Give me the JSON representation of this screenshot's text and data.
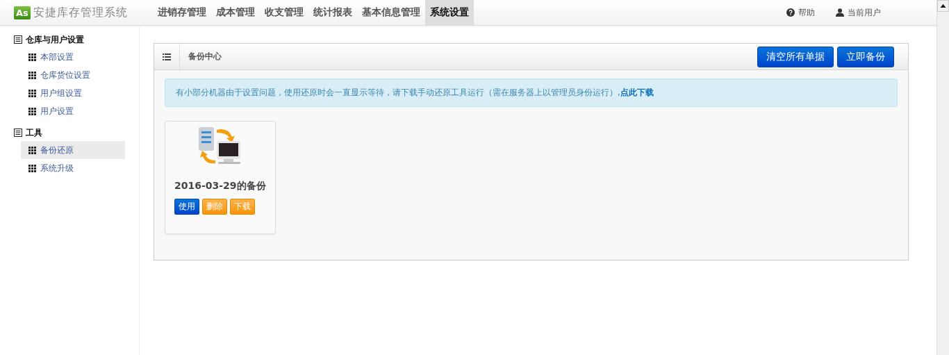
{
  "header": {
    "logo_mark": "As",
    "logo_text": "安捷库存管理系统",
    "nav": [
      {
        "label": "进销存管理",
        "selected": false
      },
      {
        "label": "成本管理",
        "selected": false
      },
      {
        "label": "收支管理",
        "selected": false
      },
      {
        "label": "统计报表",
        "selected": false
      },
      {
        "label": "基本信息管理",
        "selected": false
      },
      {
        "label": "系统设置",
        "selected": true
      }
    ],
    "help": "帮助",
    "user_label": "当前用户"
  },
  "sidebar": {
    "groups": [
      {
        "title": "仓库与用户设置",
        "items": [
          {
            "label": "本部设置",
            "selected": false
          },
          {
            "label": "仓库货位设置",
            "selected": false
          },
          {
            "label": "用户组设置",
            "selected": false
          },
          {
            "label": "用户设置",
            "selected": false
          }
        ]
      },
      {
        "title": "工具",
        "items": [
          {
            "label": "备份还原",
            "selected": true
          },
          {
            "label": "系统升级",
            "selected": false
          }
        ]
      }
    ]
  },
  "panel": {
    "title": "备份中心",
    "actions": [
      "清空所有单据",
      "立即备份"
    ],
    "notice": "有小部分机器由于设置问题，使用还原时会一直显示等待，请下载手动还原工具运行（需在服务器上以管理员身份运行）,",
    "notice_link": "点此下载",
    "backups": [
      {
        "name": "2016-03-29的备份",
        "buttons": [
          {
            "label": "使用",
            "kind": "primary"
          },
          {
            "label": "删除",
            "kind": "warning"
          },
          {
            "label": "下载",
            "kind": "warning"
          }
        ]
      }
    ]
  }
}
